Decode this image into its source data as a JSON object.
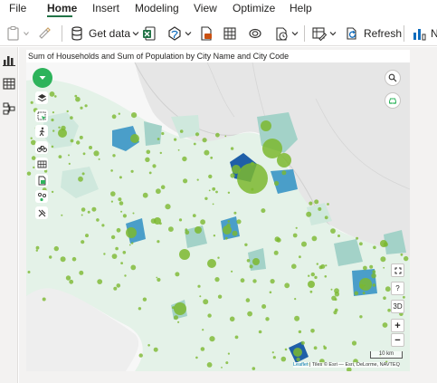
{
  "menu": {
    "items": [
      "File",
      "Home",
      "Insert",
      "Modeling",
      "View",
      "Optimize",
      "Help"
    ],
    "active": "Home"
  },
  "ribbon": {
    "get_data_label": "Get data",
    "refresh_label": "Refresh",
    "truncated_label": "N"
  },
  "visual": {
    "title": "Sum of Households and Sum of Population by City Name and City Code"
  },
  "map": {
    "buttons": {
      "zoom_in": "+",
      "zoom_out": "−",
      "three_d": "3D",
      "help": "?"
    },
    "scale_label": "10 km",
    "attribution_link": "Leaflet",
    "attribution_text": " | Tiles © Esri — Esri, DeLorme, NAVTEQ"
  },
  "colors": {
    "accent_green": "#217346",
    "bubble_green": "#7cb82f",
    "choropleth_light": "#cfe8dd",
    "choropleth_mid": "#a3d2c8",
    "choropleth_dark": "#4a9ec9",
    "choropleth_darkest": "#1f5fa8",
    "map_land": "#e6e6e6",
    "map_border": "#bdbdbd"
  }
}
